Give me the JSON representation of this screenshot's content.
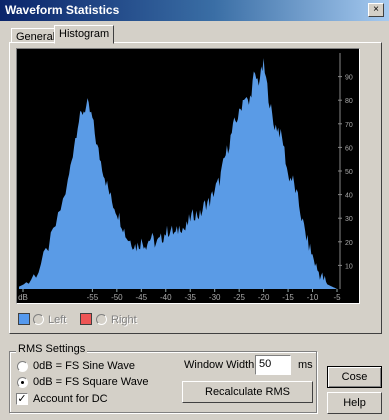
{
  "window": {
    "title": "Waveform Statistics"
  },
  "tabs": [
    {
      "label": "General"
    },
    {
      "label": "Histogram"
    }
  ],
  "legend": [
    {
      "label": "Left",
      "color": "#5599ee"
    },
    {
      "label": "Right",
      "color": "#ee5555"
    }
  ],
  "rms": {
    "group_title": "RMS Settings",
    "options": [
      {
        "label": "0dB = FS Sine Wave"
      },
      {
        "label": "0dB = FS Square Wave"
      }
    ],
    "selected_option": 1,
    "dc_label": "Account for DC",
    "dc_checked": true,
    "window_width_label": "Window Width:",
    "window_width_value": "50",
    "window_width_unit": "ms",
    "recalc_label": "Recalculate RMS"
  },
  "buttons": {
    "close": "Cose",
    "help": "Help"
  },
  "chart_data": {
    "type": "area",
    "color": "#5a9be6",
    "background": "#000000",
    "xlim": [
      -70,
      -5
    ],
    "ylim": [
      0,
      100
    ],
    "x_tick_labels": [
      "dB",
      "-55",
      "-50",
      "-45",
      "-40",
      "-35",
      "-30",
      "-25",
      "-20",
      "-15",
      "-10",
      "-5"
    ],
    "y_tick_labels": [
      "10",
      "20",
      "30",
      "40",
      "50",
      "60",
      "70",
      "80",
      "90"
    ],
    "x": [
      -70,
      -68,
      -66,
      -64,
      -62,
      -60,
      -59,
      -58,
      -57,
      -56,
      -55,
      -54,
      -53,
      -52,
      -51,
      -50,
      -49,
      -48,
      -47,
      -46,
      -45,
      -44,
      -43,
      -42,
      -41,
      -40,
      -39,
      -38,
      -37,
      -36,
      -35,
      -34,
      -33,
      -32,
      -31,
      -30,
      -29,
      -28,
      -27,
      -26,
      -25,
      -24,
      -23,
      -22,
      -21,
      -20,
      -19,
      -18,
      -17,
      -16,
      -15,
      -14,
      -13,
      -12,
      -11,
      -10,
      -9,
      -8,
      -7,
      -6,
      -5
    ],
    "values": [
      1,
      3,
      8,
      18,
      30,
      45,
      58,
      70,
      75,
      78,
      72,
      60,
      52,
      44,
      37,
      33,
      28,
      22,
      20,
      18,
      20,
      19,
      22,
      19,
      21,
      24,
      25,
      23,
      27,
      25,
      30,
      32,
      31,
      36,
      37,
      42,
      46,
      55,
      62,
      70,
      74,
      82,
      78,
      90,
      88,
      95,
      82,
      70,
      68,
      62,
      48,
      46,
      38,
      28,
      20,
      14,
      8,
      5,
      2,
      1,
      0
    ]
  }
}
